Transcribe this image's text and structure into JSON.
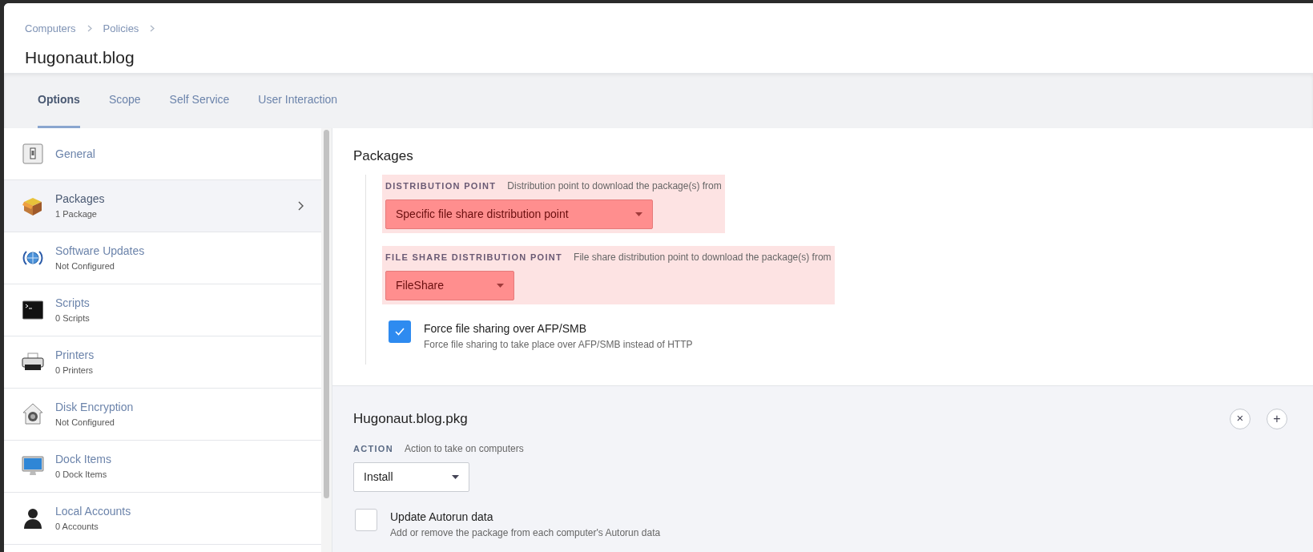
{
  "breadcrumbs": [
    "Computers",
    "Policies"
  ],
  "title": "Hugonaut.blog",
  "tabs": [
    {
      "label": "Options",
      "selected": true
    },
    {
      "label": "Scope",
      "selected": false
    },
    {
      "label": "Self Service",
      "selected": false
    },
    {
      "label": "User Interaction",
      "selected": false
    }
  ],
  "sidebar": {
    "items": [
      {
        "title": "General",
        "selected": false
      },
      {
        "title": "Packages",
        "subtitle": "1 Package",
        "selected": true
      },
      {
        "title": "Software Updates",
        "subtitle": "Not Configured",
        "selected": false
      },
      {
        "title": "Scripts",
        "subtitle": "0 Scripts",
        "selected": false
      },
      {
        "title": "Printers",
        "subtitle": "0 Printers",
        "selected": false
      },
      {
        "title": "Disk Encryption",
        "subtitle": "Not Configured",
        "selected": false
      },
      {
        "title": "Dock Items",
        "subtitle": "0 Dock Items",
        "selected": false
      },
      {
        "title": "Local Accounts",
        "subtitle": "0 Accounts",
        "selected": false
      }
    ]
  },
  "packages": {
    "heading": "Packages",
    "fields": [
      {
        "label": "DISTRIBUTION POINT",
        "hint": "Distribution point to download the package(s) from",
        "value": "Specific file share distribution point",
        "error": true
      },
      {
        "label": "FILE SHARE DISTRIBUTION POINT",
        "hint": "File share distribution point to download the package(s) from",
        "value": "FileShare",
        "error": true
      }
    ],
    "option": {
      "label": "Force file sharing over AFP/SMB",
      "description": "Force file sharing to take place over AFP/SMB instead of HTTP",
      "checked": true
    }
  },
  "package": {
    "name": "Hugonaut.blog.pkg",
    "close": "×",
    "add": "+",
    "field": {
      "label": "ACTION",
      "hint": "Action to take on computers",
      "value": "Install",
      "error": false
    },
    "option": {
      "label": "Update Autorun data",
      "description": "Add or remove the package from each computer's Autorun data",
      "checked": false
    }
  }
}
